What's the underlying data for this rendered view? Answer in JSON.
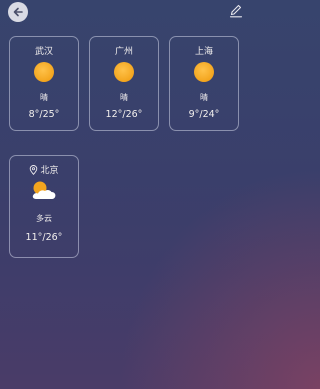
{
  "toolbar": {
    "back_icon": "arrow-left-icon",
    "edit_icon": "pencil-icon"
  },
  "cities": [
    {
      "name": "武汉",
      "condition": "晴",
      "temp": "8°/25°",
      "icon": "sun-icon",
      "current_location": false
    },
    {
      "name": "广州",
      "condition": "晴",
      "temp": "12°/26°",
      "icon": "sun-icon",
      "current_location": false
    },
    {
      "name": "上海",
      "condition": "晴",
      "temp": "9°/24°",
      "icon": "sun-icon",
      "current_location": false
    },
    {
      "name": "北京",
      "condition": "多云",
      "temp": "11°/26°",
      "icon": "partly-cloudy-icon",
      "current_location": true
    }
  ],
  "colors": {
    "sun": "#f3a51e",
    "card_border": "#cdd2e6",
    "text": "#f3f0ee"
  }
}
